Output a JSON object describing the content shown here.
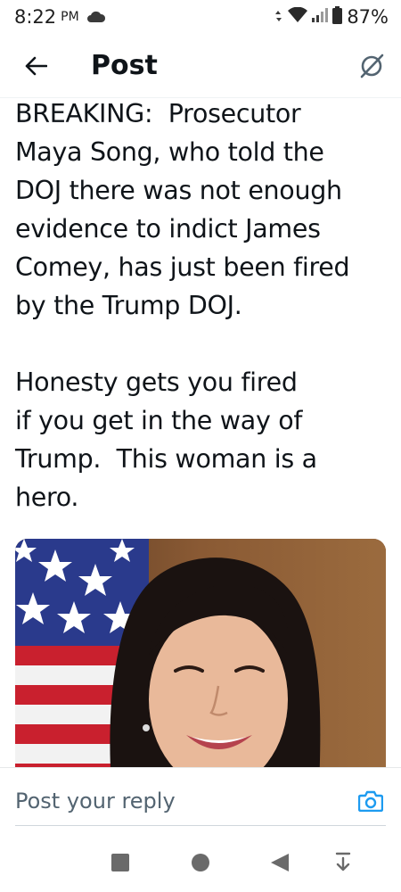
{
  "status_bar": {
    "time": "8:22",
    "ampm": "PM",
    "battery_percent": "87%"
  },
  "header": {
    "title": "Post",
    "back_icon": "arrow-left-icon",
    "right_icon": "grok-slash-icon"
  },
  "post": {
    "text": "BREAKING:  Prosecutor\nMaya Song, who told the\nDOJ there was not enough\nevidence to indict James\nComey, has just been fired\nby the Trump DOJ.\n\nHonesty gets you fired\nif you get in the way of\nTrump.  This woman is a\nhero.",
    "image_alt": "Portrait of Maya Song in front of an American flag"
  },
  "reply": {
    "placeholder": "Post your reply",
    "camera_icon": "camera-icon"
  },
  "nav": {
    "recents_icon": "square-icon",
    "home_icon": "circle-icon",
    "back_icon": "triangle-back-icon",
    "extra_icon": "arrow-down-bar-icon"
  },
  "colors": {
    "accent": "#1d9bf0",
    "text": "#0f1419",
    "secondary": "#536471"
  }
}
